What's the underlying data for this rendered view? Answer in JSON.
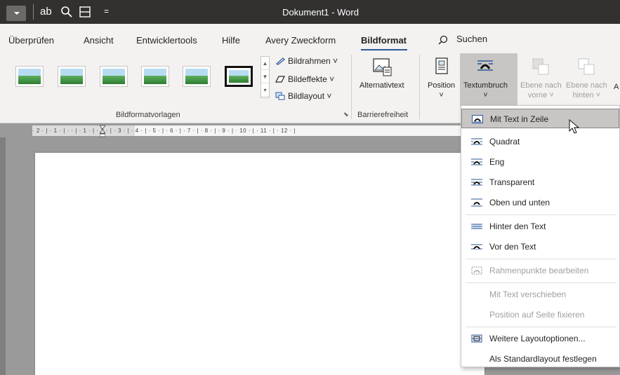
{
  "window": {
    "title": "Dokument1 - Word"
  },
  "quick_access": {
    "ab_label": "ab",
    "more_label": "="
  },
  "tabs": [
    {
      "label": "Überprüfen"
    },
    {
      "label": "Ansicht"
    },
    {
      "label": "Entwicklertools"
    },
    {
      "label": "Hilfe"
    },
    {
      "label": "Avery Zweckform"
    },
    {
      "label": "Bildformat"
    }
  ],
  "tell_me": {
    "label": "Suchen"
  },
  "ribbon": {
    "styles_group": {
      "label": "Bildformatvorlagen",
      "border_label": "Bildrahmen",
      "effects_label": "Bildeffekte",
      "layout_label": "Bildlayout"
    },
    "accessibility_group": {
      "label": "Barrierefreiheit",
      "alt_text_label": "Alternativtext"
    },
    "arrange": {
      "position_label": "Position",
      "wrap_label": "Textumbruch",
      "forward_label_1": "Ebene nach",
      "forward_label_2": "vorne",
      "backward_label_1": "Ebene nach",
      "backward_label_2": "hinten",
      "cut_label": "A"
    }
  },
  "ruler": {
    "text": "· 2 · | · 1 · | ·   · | · 1 · | · 2 · | · 3 · | · 4 · | · 5 · | · 6 · | · 7 · | · 8 · | · 9 · | · 10 · | · 11 · | · 12 · |"
  },
  "wrap_menu": {
    "items": [
      {
        "label": "Mit Text in Zeile",
        "icon": "inline-wrap-icon",
        "enabled": true,
        "highlighted": true
      },
      {
        "label": "Quadrat",
        "icon": "square-wrap-icon",
        "enabled": true
      },
      {
        "label": "Eng",
        "icon": "tight-wrap-icon",
        "enabled": true
      },
      {
        "label": "Transparent",
        "icon": "through-wrap-icon",
        "enabled": true
      },
      {
        "label": "Oben und unten",
        "icon": "top-bottom-wrap-icon",
        "enabled": true
      },
      {
        "label": "Hinter den Text",
        "icon": "behind-text-icon",
        "enabled": true
      },
      {
        "label": "Vor den Text",
        "icon": "in-front-text-icon",
        "enabled": true
      },
      {
        "label": "Rahmenpunkte bearbeiten",
        "icon": "edit-wrap-points-icon",
        "enabled": false
      },
      {
        "label": "Mit Text verschieben",
        "enabled": false
      },
      {
        "label": "Position auf Seite fixieren",
        "enabled": false
      },
      {
        "label": "Weitere Layoutoptionen...",
        "icon": "layout-options-icon",
        "enabled": true
      },
      {
        "label": "Als Standardlayout festlegen",
        "enabled": true
      }
    ]
  },
  "colors": {
    "accent": "#2b579a",
    "titlebar": "#323130",
    "ribbon": "#f3f2f1"
  }
}
